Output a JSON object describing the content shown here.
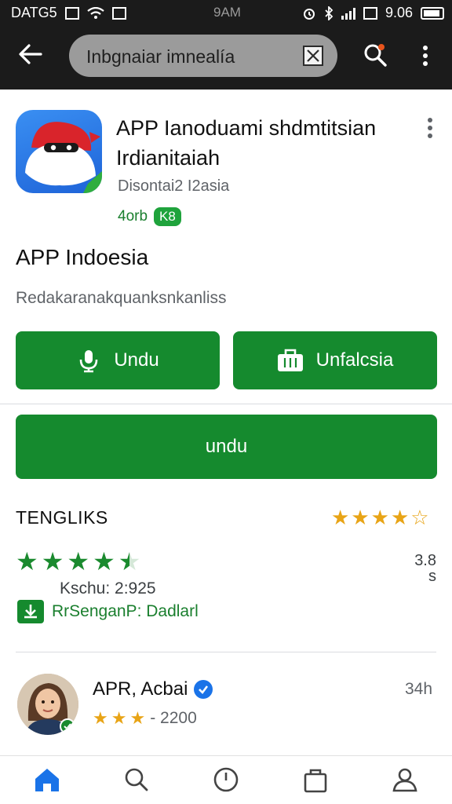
{
  "status_bar": {
    "carrier": "DATG5",
    "center": "9AM",
    "time": "9.06"
  },
  "search": {
    "query": "Inbgnaiar imnealía"
  },
  "app": {
    "title": "APP Ianoduami shdmtitsian Irdianitaiah",
    "meta": "Disontai2 I2asia",
    "rating_text": "4orb",
    "rating_badge": "K8",
    "name": "APP Indoesia",
    "description": "Redakaranakquanksnkanliss"
  },
  "buttons": {
    "left_label": "Undu",
    "right_label": "Unfalcsia",
    "main_label": "undu"
  },
  "ratings": {
    "section_title": "TENGLIKS",
    "header_stars": 4,
    "green_stars": 4.5,
    "score_line1": "3.8",
    "score_line2": "s",
    "review_count": "Kschu: 2:925",
    "download_text": "RrSenganP: Dadlarl"
  },
  "review": {
    "reviewer_name": "APR, Acbai",
    "stars": 3,
    "date": "- 2200",
    "time": "34h"
  },
  "colors": {
    "primary_green": "#158a2e",
    "star_gold": "#e8a416",
    "star_green": "#1a8a2e",
    "top_bar": "#1b1b1b"
  },
  "bottom_nav": {
    "items": [
      "home-icon",
      "search-icon",
      "clock-icon",
      "bag-icon",
      "profile-icon"
    ]
  }
}
